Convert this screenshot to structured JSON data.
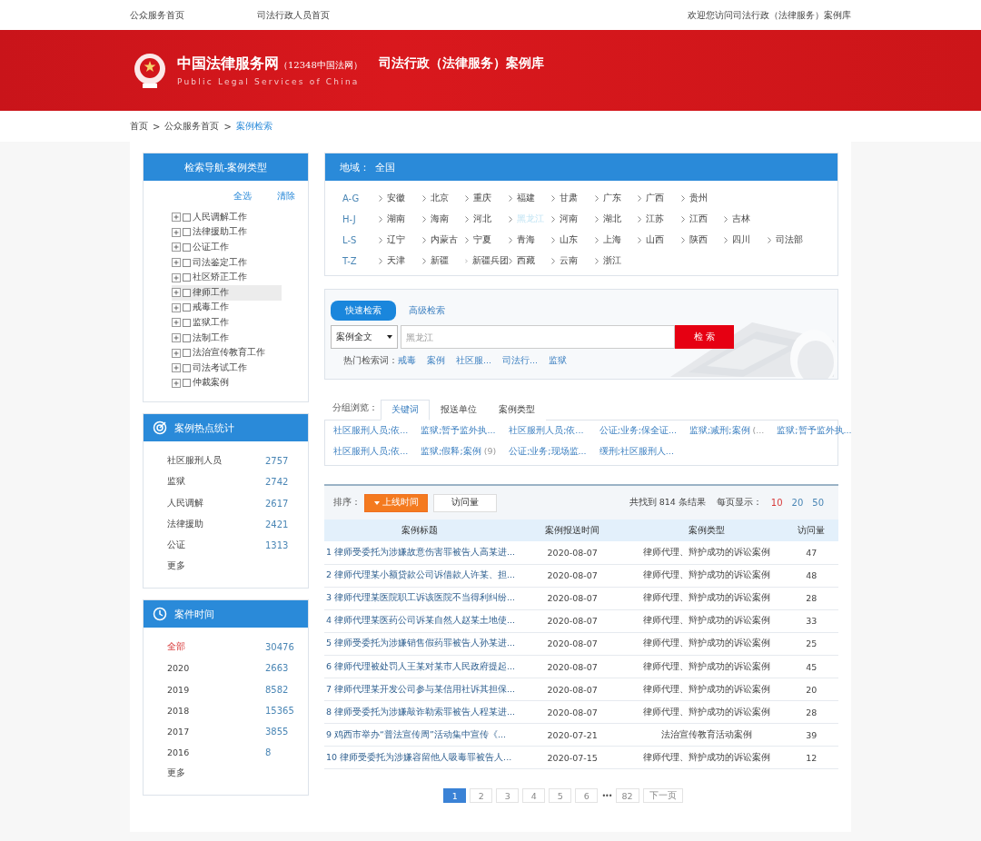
{
  "top_links": {
    "left": [
      "公众服务首页",
      "司法行政人员首页"
    ],
    "right": "欢迎您访问司法行政（法律服务）案例库"
  },
  "banner": {
    "site_name": "中国法律服务网",
    "site_sub": "（12348中国法网）",
    "english": "Public Legal Services of China",
    "title": "司法行政（法律服务）案例库"
  },
  "breadcrumb": {
    "separator": ">",
    "items": [
      {
        "label": "首页",
        "current": false
      },
      {
        "label": "公众服务首页",
        "current": false
      },
      {
        "label": "案例检索",
        "current": true
      }
    ]
  },
  "nav_panel": {
    "title": "检索导航-案例类型",
    "select_all": "全选",
    "clear": "清除",
    "items": [
      {
        "label": "人民调解工作",
        "checked": false,
        "selected": false
      },
      {
        "label": "法律援助工作",
        "checked": false,
        "selected": false
      },
      {
        "label": "公证工作",
        "checked": false,
        "selected": false
      },
      {
        "label": "司法鉴定工作",
        "checked": false,
        "selected": false
      },
      {
        "label": "社区矫正工作",
        "checked": false,
        "selected": false
      },
      {
        "label": "律师工作",
        "checked": false,
        "selected": true
      },
      {
        "label": "戒毒工作",
        "checked": false,
        "selected": false
      },
      {
        "label": "监狱工作",
        "checked": false,
        "selected": false
      },
      {
        "label": "法制工作",
        "checked": false,
        "selected": false
      },
      {
        "label": "法治宣传教育工作",
        "checked": false,
        "selected": false
      },
      {
        "label": "司法考试工作",
        "checked": false,
        "selected": false
      },
      {
        "label": "仲裁案例",
        "checked": false,
        "selected": false
      }
    ]
  },
  "hot_stats": {
    "title": "案例热点统计",
    "rows": [
      {
        "label": "社区服刑人员",
        "count": "2757"
      },
      {
        "label": "监狱",
        "count": "2742"
      },
      {
        "label": "人民调解",
        "count": "2617"
      },
      {
        "label": "法律援助",
        "count": "2421"
      },
      {
        "label": "公证",
        "count": "1313"
      }
    ],
    "more": "更多"
  },
  "case_time": {
    "title": "案件时间",
    "rows": [
      {
        "label": "全部",
        "count": "30476",
        "selected": true
      },
      {
        "label": "2020",
        "count": "2663",
        "selected": false
      },
      {
        "label": "2019",
        "count": "8582",
        "selected": false
      },
      {
        "label": "2018",
        "count": "15365",
        "selected": false
      },
      {
        "label": "2017",
        "count": "3855",
        "selected": false
      },
      {
        "label": "2016",
        "count": "8",
        "selected": false
      }
    ],
    "more": "更多"
  },
  "region": {
    "label": "地域：",
    "value": "全国",
    "groups": [
      {
        "range": "A-G",
        "items": [
          {
            "name": "安徽",
            "selected": false
          },
          {
            "name": "北京",
            "selected": false
          },
          {
            "name": "重庆",
            "selected": false
          },
          {
            "name": "福建",
            "selected": false
          },
          {
            "name": "甘肃",
            "selected": false
          },
          {
            "name": "广东",
            "selected": false
          },
          {
            "name": "广西",
            "selected": false
          },
          {
            "name": "贵州",
            "selected": false
          }
        ]
      },
      {
        "range": "H-J",
        "items": [
          {
            "name": "湖南",
            "selected": false
          },
          {
            "name": "海南",
            "selected": false
          },
          {
            "name": "河北",
            "selected": false
          },
          {
            "name": "黑龙江",
            "selected": true
          },
          {
            "name": "河南",
            "selected": false
          },
          {
            "name": "湖北",
            "selected": false
          },
          {
            "name": "江苏",
            "selected": false
          },
          {
            "name": "江西",
            "selected": false
          },
          {
            "name": "吉林",
            "selected": false
          }
        ]
      },
      {
        "range": "L-S",
        "items": [
          {
            "name": "辽宁",
            "selected": false
          },
          {
            "name": "内蒙古",
            "selected": false
          },
          {
            "name": "宁夏",
            "selected": false
          },
          {
            "name": "青海",
            "selected": false
          },
          {
            "name": "山东",
            "selected": false
          },
          {
            "name": "上海",
            "selected": false
          },
          {
            "name": "山西",
            "selected": false
          },
          {
            "name": "陕西",
            "selected": false
          },
          {
            "name": "四川",
            "selected": false
          },
          {
            "name": "司法部",
            "selected": false
          }
        ]
      },
      {
        "range": "T-Z",
        "items": [
          {
            "name": "天津",
            "selected": false
          },
          {
            "name": "新疆",
            "selected": false
          },
          {
            "name": "新疆兵团",
            "selected": false
          },
          {
            "name": "西藏",
            "selected": false
          },
          {
            "name": "云南",
            "selected": false
          },
          {
            "name": "浙江",
            "selected": false
          }
        ]
      }
    ]
  },
  "search": {
    "tabs": [
      {
        "label": "快速检索",
        "selected": true
      },
      {
        "label": "高级检索",
        "selected": false
      }
    ],
    "scope": "案例全文",
    "placeholder": "黑龙江",
    "button": "检 索",
    "hot_label": "热门检索词：",
    "hot_terms": [
      "戒毒",
      "案例",
      "社区服...",
      "司法行...",
      "监狱"
    ]
  },
  "browse": {
    "label": "分组浏览：",
    "tabs": [
      {
        "label": "关键词",
        "selected": true
      },
      {
        "label": "报送单位",
        "selected": false
      },
      {
        "label": "案例类型",
        "selected": false
      }
    ],
    "keywords": [
      {
        "text": "社区服刑人员;依..."
      },
      {
        "text": "监狱;暂予监外执..."
      },
      {
        "text": "社区服刑人员;依..."
      },
      {
        "text": "公证;业务;保全证..."
      },
      {
        "text": "监狱;减刑;案例",
        "count": "(..."
      },
      {
        "text": "监狱;暂予监外执..."
      },
      {
        "text": "社区服刑人员;依..."
      },
      {
        "text": "监狱;假释;案例",
        "count": "(9)"
      },
      {
        "text": "公证;业务;现场监..."
      },
      {
        "text": "缓刑;社区服刑人..."
      }
    ]
  },
  "results": {
    "sort_label": "排序：",
    "sorts": [
      {
        "label": "上线时间",
        "selected": true
      },
      {
        "label": "访问量",
        "selected": false
      }
    ],
    "summary": "共找到 814 条结果",
    "per_page_label": "每页显示：",
    "per_page": [
      {
        "label": "10",
        "selected": true
      },
      {
        "label": "20",
        "selected": false
      },
      {
        "label": "50",
        "selected": false
      }
    ],
    "columns": [
      "案例标题",
      "案例报送时间",
      "案例类型",
      "访问量"
    ],
    "rows": [
      {
        "title": "1 律师受委托为涉嫌故意伤害罪被告人高某进...",
        "date": "2020-08-07",
        "type": "律师代理、辩护成功的诉讼案例",
        "visits": "47"
      },
      {
        "title": "2 律师代理某小额贷款公司诉借款人许某、担...",
        "date": "2020-08-07",
        "type": "律师代理、辩护成功的诉讼案例",
        "visits": "48"
      },
      {
        "title": "3 律师代理某医院职工诉该医院不当得利纠纷...",
        "date": "2020-08-07",
        "type": "律师代理、辩护成功的诉讼案例",
        "visits": "28"
      },
      {
        "title": "4 律师代理某医药公司诉某自然人赵某土地使...",
        "date": "2020-08-07",
        "type": "律师代理、辩护成功的诉讼案例",
        "visits": "33"
      },
      {
        "title": "5 律师受委托为涉嫌销售假药罪被告人孙某进...",
        "date": "2020-08-07",
        "type": "律师代理、辩护成功的诉讼案例",
        "visits": "25"
      },
      {
        "title": "6 律师代理被处罚人王某对某市人民政府提起...",
        "date": "2020-08-07",
        "type": "律师代理、辩护成功的诉讼案例",
        "visits": "45"
      },
      {
        "title": "7 律师代理某开发公司参与某信用社诉其担保...",
        "date": "2020-08-07",
        "type": "律师代理、辩护成功的诉讼案例",
        "visits": "20"
      },
      {
        "title": "8 律师受委托为涉嫌敲诈勒索罪被告人程某进...",
        "date": "2020-08-07",
        "type": "律师代理、辩护成功的诉讼案例",
        "visits": "28"
      },
      {
        "title": "9 鸡西市举办“普法宣传周”活动集中宣传《...",
        "date": "2020-07-21",
        "type": "法治宣传教育活动案例",
        "visits": "39"
      },
      {
        "title": "10 律师受委托为涉嫌容留他人吸毒罪被告人...",
        "date": "2020-07-15",
        "type": "律师代理、辩护成功的诉讼案例",
        "visits": "12"
      }
    ]
  },
  "pagination": {
    "pages": [
      {
        "label": "1",
        "selected": true
      },
      {
        "label": "2",
        "selected": false
      },
      {
        "label": "3",
        "selected": false
      },
      {
        "label": "4",
        "selected": false
      },
      {
        "label": "5",
        "selected": false
      },
      {
        "label": "6",
        "selected": false
      }
    ],
    "ellipsis": "•••",
    "last": "82",
    "next": "下一页"
  }
}
